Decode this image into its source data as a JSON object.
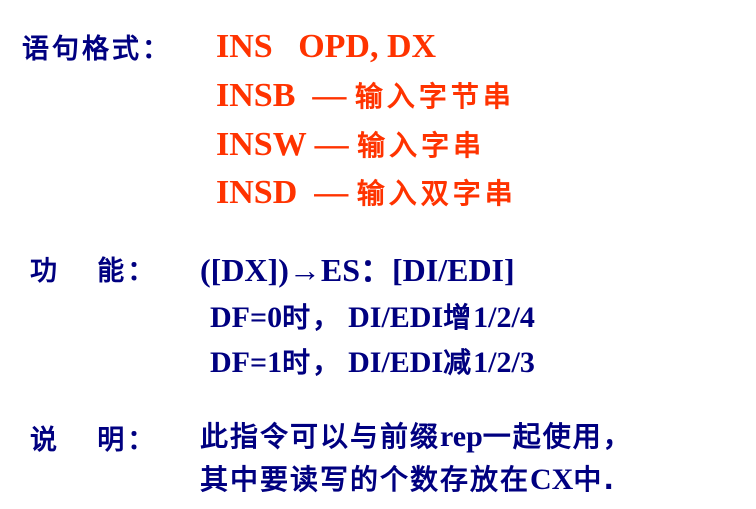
{
  "syntax": {
    "label": "语句格式：",
    "lines": [
      {
        "code": "INS   OPD, DX",
        "desc": ""
      },
      {
        "code": "INSB  — ",
        "desc": "输入字节串"
      },
      {
        "code": "INSW — ",
        "desc": "输入字串"
      },
      {
        "code": "INSD  — ",
        "desc": "输入双字串"
      }
    ]
  },
  "function": {
    "label": "功   能：",
    "line1": "([DX])→ES：[DI/EDI]",
    "line2_a": "DF=0",
    "line2_b": "时，",
    "line2_c": "DI/EDI",
    "line2_d": "增",
    "line2_e": "1/2/4",
    "line3_a": "DF=1",
    "line3_b": "时，",
    "line3_c": "DI/EDI",
    "line3_d": "减",
    "line3_e": "1/2/3"
  },
  "note": {
    "label": "说   明：",
    "line1_a": "此指令可以与前缀",
    "line1_b": "rep",
    "line1_c": "一起使用，",
    "line2_a": "其中要读写的个数存放在",
    "line2_b": "CX",
    "line2_c": "中."
  },
  "colors": {
    "accent": "#FF3300",
    "text": "#000080"
  }
}
